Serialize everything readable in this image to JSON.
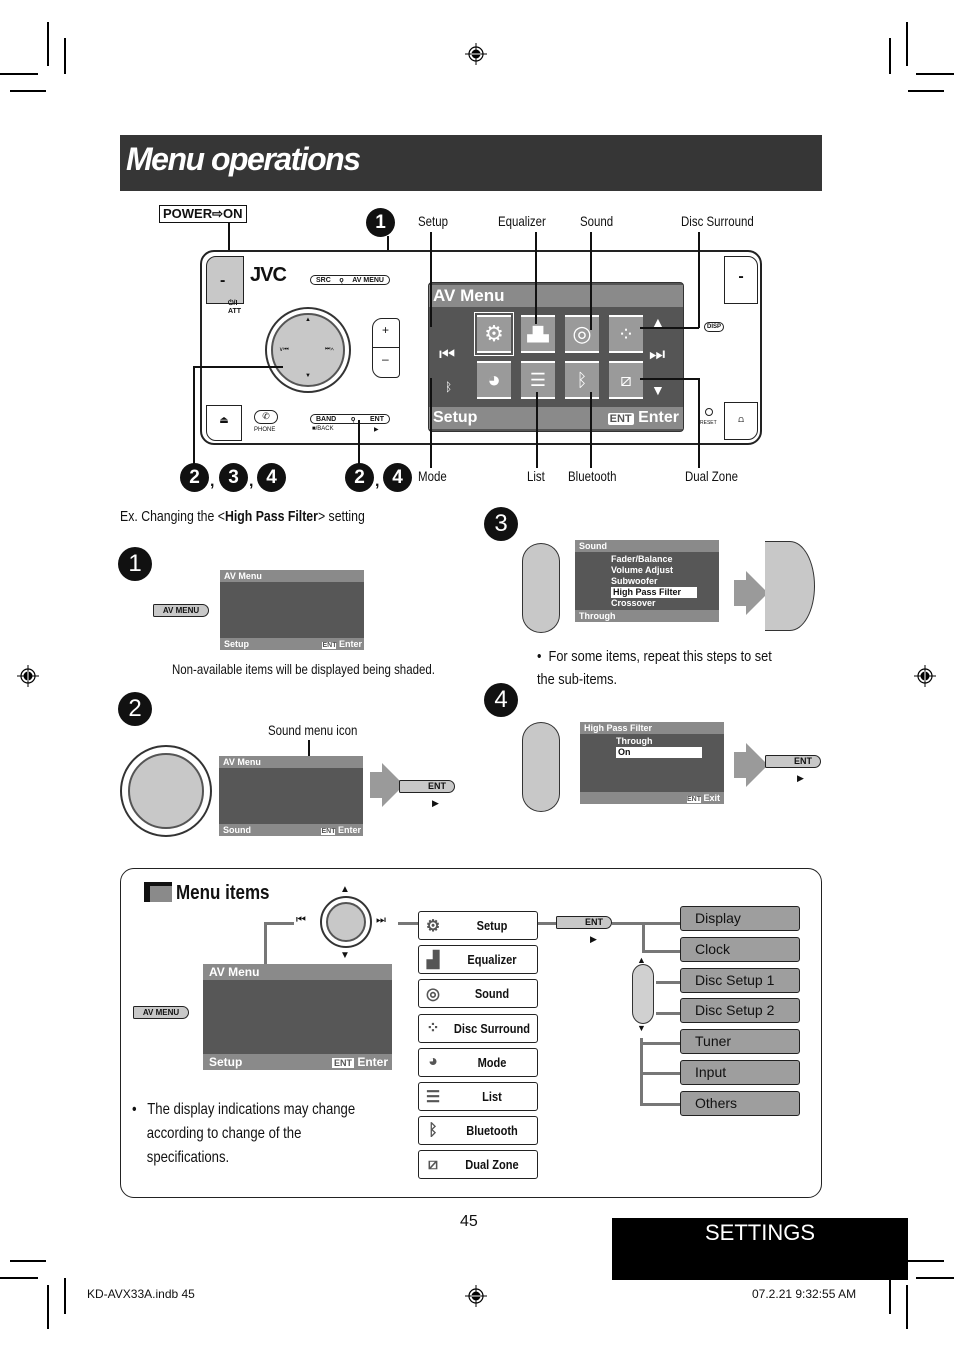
{
  "page": {
    "title": "Menu operations",
    "section_tab": "SETTINGS",
    "page_number": "45",
    "footer_left": "KD-AVX33A.indb   45",
    "footer_right": "07.2.21   9:32:55 AM"
  },
  "device_diagram": {
    "power_label": "POWER⇨ON",
    "brand": "JVC",
    "callouts_top": [
      "Setup",
      "Equalizer",
      "Sound",
      "Disc Surround"
    ],
    "callouts_bottom": [
      "Mode",
      "List",
      "Bluetooth",
      "Dual Zone"
    ],
    "step_markers_left": [
      "2",
      "3",
      "4"
    ],
    "step_markers_mid": [
      "2",
      "4"
    ],
    "step_marker_top": "1",
    "buttons": {
      "src": "SRC",
      "av_menu": "AV MENU",
      "band": "BAND",
      "ent": "ENT",
      "back": "■/BACK",
      "play": "▶",
      "phone": "PHONE",
      "att": "⏻/I ATT",
      "plus": "+",
      "minus": "–",
      "disp": "DISP",
      "reset": "RESET",
      "prev": "∨⏮",
      "next": "⏭∧"
    },
    "screen": {
      "header": "AV Menu",
      "footer_left": "Setup",
      "footer_ent": "ENT",
      "footer_right": "Enter"
    }
  },
  "example": {
    "prefix": "Ex. Changing the <",
    "bold": "High Pass Filter",
    "suffix": "> setting"
  },
  "steps": [
    {
      "number": "1",
      "button": "AV MENU",
      "screen": {
        "header": "AV Menu",
        "footer_left": "Setup",
        "footer_ent": "ENT",
        "footer_right": "Enter"
      },
      "note": "Non-available items will be displayed being shaded."
    },
    {
      "number": "2",
      "callout": "Sound menu icon",
      "screen": {
        "header": "AV Menu",
        "footer_left": "Sound",
        "footer_ent": "ENT",
        "footer_right": "Enter"
      },
      "button": "ENT"
    },
    {
      "number": "3",
      "screen": {
        "header": "Sound",
        "items": [
          "Fader/Balance",
          "Volume Adjust",
          "Subwoofer",
          "High Pass Filter",
          "Crossover"
        ],
        "selected_index": 3,
        "footer_left": "Through"
      },
      "note": "For some items, repeat this steps to set the sub-items."
    },
    {
      "number": "4",
      "screen": {
        "header": "High Pass Filter",
        "items": [
          "Through",
          "On"
        ],
        "selected_index": 1,
        "footer_ent": "ENT",
        "footer_right": "Exit"
      },
      "button": "ENT"
    }
  ],
  "menu_items": {
    "heading": "Menu items",
    "av_menu_button": "AV MENU",
    "screen": {
      "header": "AV Menu",
      "footer_left": "Setup",
      "footer_ent": "ENT",
      "footer_right": "Enter"
    },
    "ent_button": "ENT",
    "main": [
      {
        "label": "Setup",
        "icon": "gears-icon"
      },
      {
        "label": "Equalizer",
        "icon": "equalizer-icon"
      },
      {
        "label": "Sound",
        "icon": "speaker-icon"
      },
      {
        "label": "Disc Surround",
        "icon": "surround-icon"
      },
      {
        "label": "Mode",
        "icon": "mode-icon"
      },
      {
        "label": "List",
        "icon": "list-icon"
      },
      {
        "label": "Bluetooth",
        "icon": "bluetooth-icon"
      },
      {
        "label": "Dual Zone",
        "icon": "dual-zone-icon"
      }
    ],
    "setup_sub": [
      "Display",
      "Clock",
      "Disc Setup 1",
      "Disc Setup 2",
      "Tuner",
      "Input",
      "Others"
    ],
    "note": "The display indications may change according to change of the specifications."
  },
  "icons": {
    "gears": "⚙",
    "equalizer": "▐▃▅█",
    "speaker": "◎",
    "surround": "⁘",
    "mode": "◕",
    "list": "☰",
    "bluetooth": "ᛒ",
    "dual": "⧄",
    "prev": "⏮",
    "next": "⏭",
    "up": "▲",
    "down": "▼",
    "play": "▶",
    "bt_small": "ᛒ"
  }
}
